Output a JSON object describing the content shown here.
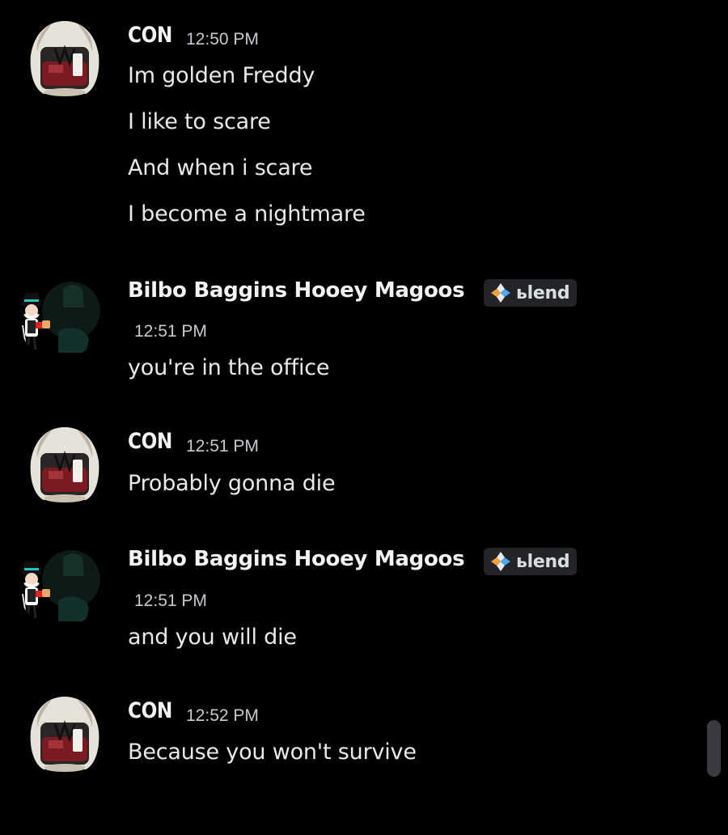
{
  "messages": [
    {
      "author": "CON",
      "time": "12:50 PM",
      "lines": [
        "Im golden Freddy",
        "I like to scare",
        "And when i scare",
        "I become a nightmare"
      ]
    },
    {
      "author": "Bilbo Baggins Hooey Magoos",
      "tag": "ьlend",
      "time": "12:51 PM",
      "lines": [
        "you're in the office"
      ]
    },
    {
      "author": "CON",
      "time": "12:51 PM",
      "lines": [
        "Probably gonna die"
      ]
    },
    {
      "author": "Bilbo Baggins Hooey Magoos",
      "tag": "ьlend",
      "time": "12:51 PM",
      "lines": [
        "and you will die"
      ]
    },
    {
      "author": "CON",
      "time": "12:52 PM",
      "lines": [
        "Because you won't survive"
      ]
    }
  ],
  "icons": {
    "con_avatar": "golden-freddy-avatar",
    "bilbo_avatar": "monopoly-man-avatar",
    "tag_icon": "diamond-tag-icon"
  },
  "colors": {
    "background": "#000000",
    "text": "#e9e9ec",
    "timestamp": "#c8c9cf",
    "tag_background": "#232428"
  }
}
